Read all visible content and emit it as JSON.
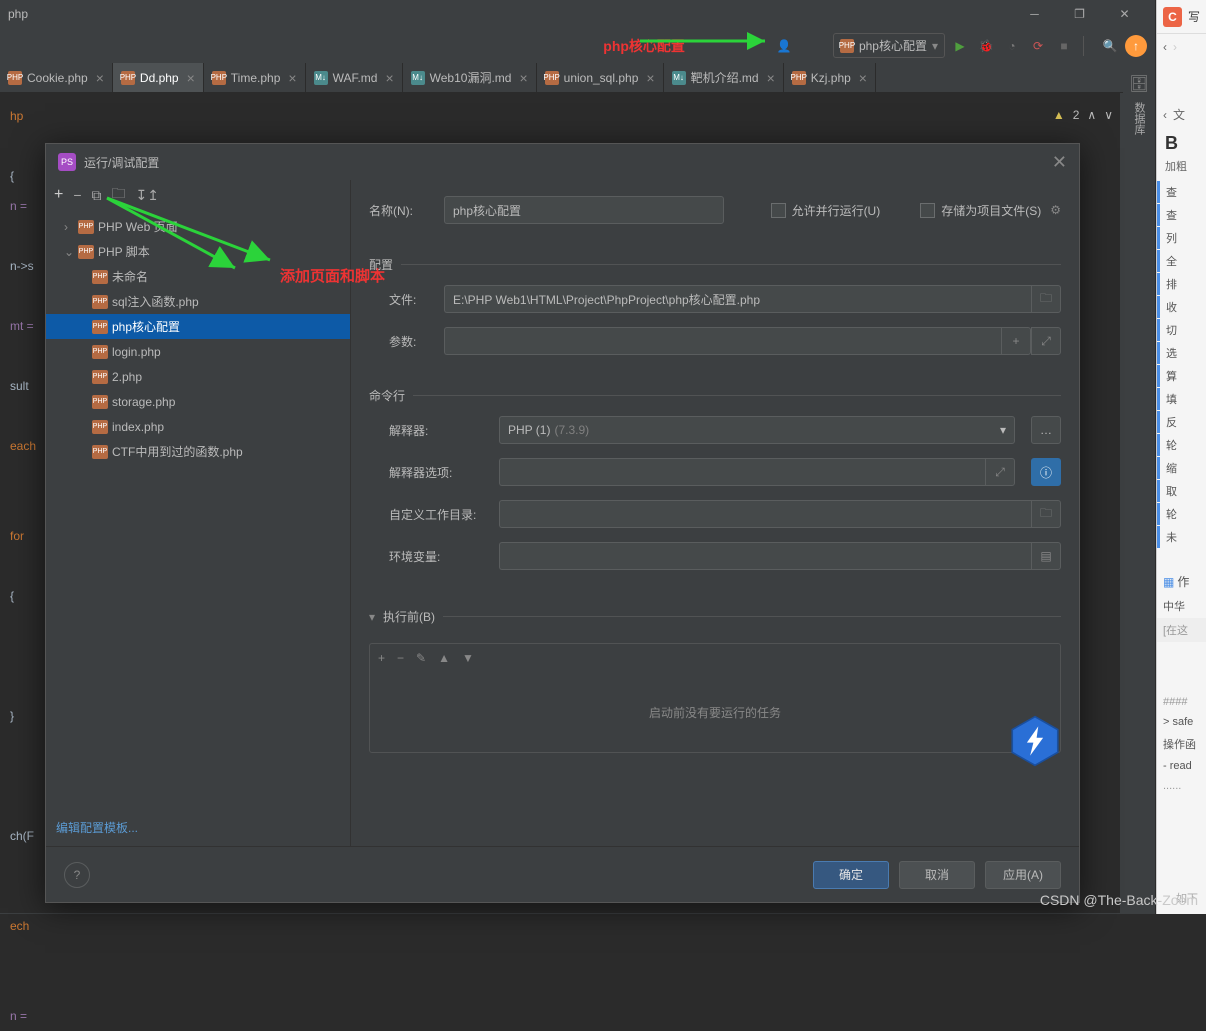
{
  "title_bar": {
    "title": "php"
  },
  "toolbar": {
    "red_label": "php核心配置",
    "run_config": "php核心配置"
  },
  "tabs": [
    {
      "label": "Cookie.php",
      "type": "php"
    },
    {
      "label": "Dd.php",
      "type": "php",
      "active": true
    },
    {
      "label": "Time.php",
      "type": "php"
    },
    {
      "label": "WAF.md",
      "type": "md"
    },
    {
      "label": "Web10漏洞.md",
      "type": "md"
    },
    {
      "label": "union_sql.php",
      "type": "php"
    },
    {
      "label": "靶机介绍.md",
      "type": "md"
    },
    {
      "label": "Kzj.php",
      "type": "php"
    }
  ],
  "status": {
    "warn_count": "2"
  },
  "code_lines": [
    "hp",
    "",
    "{",
    "n =",
    "",
    "n->s",
    "",
    "mt =",
    "",
    "sult",
    "",
    "each",
    "",
    "",
    "for",
    "",
    "{",
    "",
    "",
    "",
    "}",
    "",
    "",
    "",
    "ch(F",
    "",
    "",
    "ech",
    "",
    "",
    "n ="
  ],
  "dialog": {
    "title": "运行/调试配置",
    "tree": {
      "cat1": "PHP Web 页面",
      "cat2": "PHP 脚本",
      "items": [
        {
          "label": "未命名"
        },
        {
          "label": "sql注入函数.php"
        },
        {
          "label": "php核心配置",
          "selected": true
        },
        {
          "label": "login.php"
        },
        {
          "label": "2.php"
        },
        {
          "label": "storage.php"
        },
        {
          "label": "index.php"
        },
        {
          "label": "CTF中用到过的函数.php"
        }
      ]
    },
    "edit_template": "编辑配置模板...",
    "form": {
      "name_label": "名称(N):",
      "name_value": "php核心配置",
      "allow_parallel": "允许并行运行(U)",
      "store_as_project": "存储为项目文件(S)",
      "section_config": "配置",
      "file_label": "文件:",
      "file_value": "E:\\PHP Web1\\HTML\\Project\\PhpProject\\php核心配置.php",
      "args_label": "参数:",
      "section_cmd": "命令行",
      "interp_label": "解释器:",
      "interp_value": "PHP (1)",
      "interp_ver": "(7.3.9)",
      "interp_opts_label": "解释器选项:",
      "workdir_label": "自定义工作目录:",
      "env_label": "环境变量:",
      "before_label": "执行前(B)",
      "before_empty": "启动前没有要运行的任务"
    },
    "buttons": {
      "ok": "确定",
      "cancel": "取消",
      "apply": "应用(A)"
    }
  },
  "annotation": {
    "add_pages": "添加页面和脚本"
  },
  "side": {
    "write": "写",
    "nav": "文",
    "bold": "B",
    "bold_sub": "加粗",
    "items": [
      "查",
      "查",
      "列",
      "全",
      "排",
      "收",
      "切",
      "选",
      "算",
      "填",
      "反",
      "轮",
      "缩",
      "取",
      "轮",
      "未"
    ],
    "table": "作",
    "cn": "中华",
    "placeholder": "[在这",
    "hash": "####",
    "safe": "> safe",
    "opfn": "操作函",
    "read": "- read",
    "dots": "......",
    "rt": "如下"
  },
  "watermark": "CSDN @The-Back-Zoom"
}
